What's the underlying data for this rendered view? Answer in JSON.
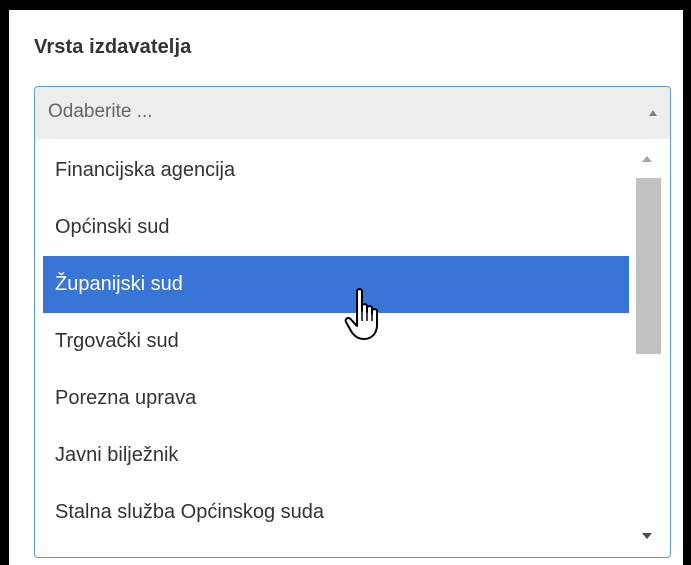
{
  "field": {
    "label": "Vrsta izdavatelja",
    "placeholder": "Odaberite ..."
  },
  "options": [
    {
      "label": "Financijska agencija",
      "selected": false
    },
    {
      "label": "Općinski sud",
      "selected": false
    },
    {
      "label": "Županijski sud",
      "selected": true
    },
    {
      "label": "Trgovački sud",
      "selected": false
    },
    {
      "label": "Porezna uprava",
      "selected": false
    },
    {
      "label": "Javni bilježnik",
      "selected": false
    },
    {
      "label": "Stalna služba Općinskog suda",
      "selected": false
    }
  ],
  "colors": {
    "highlight": "#3875d7",
    "focus_border": "#5b9bd5",
    "header_bg": "#ededed"
  },
  "cursor": "hand-pointer-icon"
}
